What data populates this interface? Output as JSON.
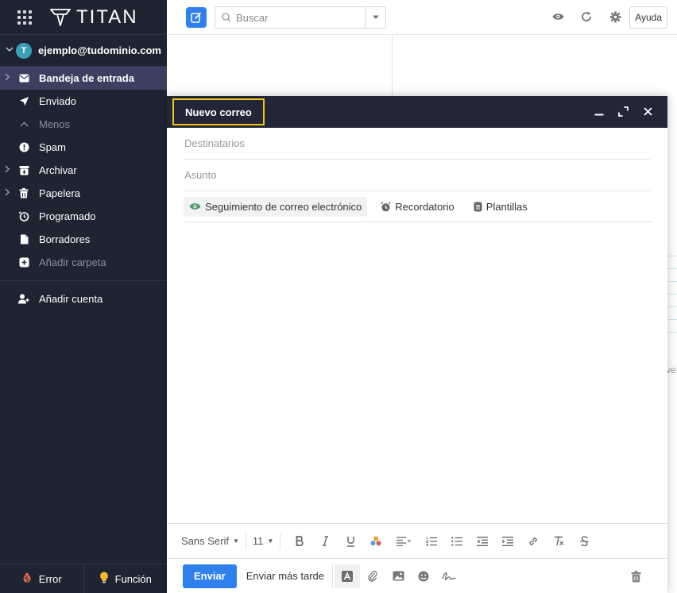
{
  "app": {
    "logo_text": "TITAN"
  },
  "account": {
    "avatar_letter": "T",
    "email": "ejemplo@tudominio.com"
  },
  "folders": [
    {
      "label": "Bandeja de entrada",
      "icon": "envelope-icon"
    },
    {
      "label": "Enviado",
      "icon": "send-icon"
    },
    {
      "label": "Menos",
      "icon": "chevron-up-icon"
    },
    {
      "label": "Spam",
      "icon": "alert-icon"
    },
    {
      "label": "Archivar",
      "icon": "archive-icon"
    },
    {
      "label": "Papelera",
      "icon": "trash-icon"
    },
    {
      "label": "Programado",
      "icon": "clock-icon"
    },
    {
      "label": "Borradores",
      "icon": "draft-icon"
    },
    {
      "label": "Añadir carpeta",
      "icon": "add-folder-icon"
    }
  ],
  "add_account": {
    "label": "Añadir cuenta"
  },
  "footer": {
    "error_label": "Error",
    "feature_label": "Función"
  },
  "topbar": {
    "search_placeholder": "Buscar",
    "help_label": "Ayuda"
  },
  "background": {
    "partial_text": "ve"
  },
  "compose": {
    "title": "Nuevo correo",
    "to_placeholder": "Destinatarios",
    "subject_placeholder": "Asunto",
    "chips": {
      "tracking": "Seguimiento de correo electrónico",
      "reminder": "Recordatorio",
      "templates": "Plantillas"
    },
    "format": {
      "font": "Sans Serif",
      "size": "11"
    },
    "send_label": "Enviar",
    "send_later_label": "Enviar más tarde"
  },
  "colors": {
    "sidebar_bg": "#1f2433",
    "active_folder_bg": "#3b4060",
    "accent": "#2f80ed",
    "compose_header_bg": "#222637",
    "highlight_border": "#f5c518"
  }
}
